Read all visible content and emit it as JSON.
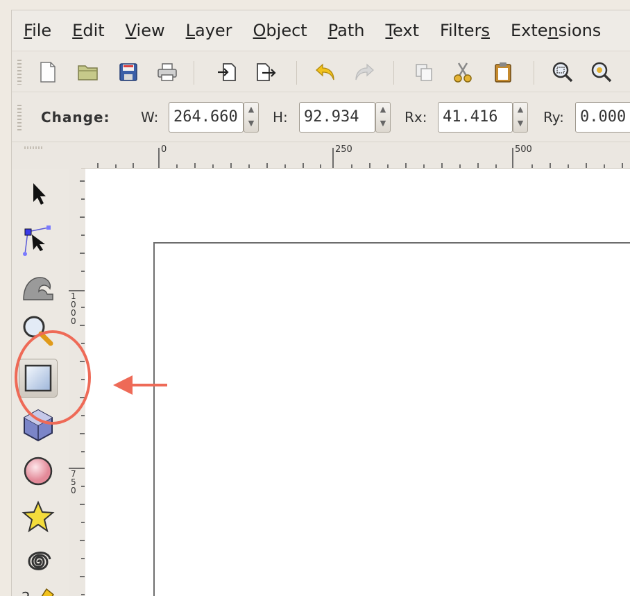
{
  "menubar": {
    "items": [
      {
        "mnemonic": "F",
        "rest": "ile"
      },
      {
        "mnemonic": "E",
        "rest": "dit"
      },
      {
        "mnemonic": "V",
        "rest": "iew"
      },
      {
        "mnemonic": "L",
        "rest": "ayer"
      },
      {
        "mnemonic": "O",
        "rest": "bject"
      },
      {
        "mnemonic": "P",
        "rest": "ath"
      },
      {
        "mnemonic": "T",
        "rest": "ext"
      },
      {
        "pre": "Filter",
        "mnemonic": "s",
        "rest": ""
      },
      {
        "pre": "Exte",
        "mnemonic": "n",
        "rest": "sions"
      }
    ]
  },
  "commands": {
    "icons": [
      "new-document-icon",
      "open-folder-icon",
      "save-icon",
      "print-icon",
      "import-icon",
      "export-icon",
      "undo-icon",
      "redo-icon",
      "duplicate-icon",
      "cut-icon",
      "paste-icon",
      "zoom-selection-icon",
      "zoom-drawing-icon"
    ]
  },
  "controls": {
    "change_label": "Change:",
    "w_label": "W:",
    "w_value": "264.660",
    "h_label": "H:",
    "h_value": "92.934",
    "rx_label": "Rx:",
    "rx_value": "41.416",
    "ry_label": "Ry:",
    "ry_value": "0.000"
  },
  "ruler": {
    "h_labels": [
      "0",
      "250",
      "500"
    ],
    "v_labels": [
      "1000",
      "750"
    ]
  },
  "toolbox": {
    "tools": [
      "selector-tool",
      "node-tool",
      "tweak-tool",
      "zoom-tool",
      "rectangle-tool",
      "3dbox-tool",
      "ellipse-tool",
      "star-tool",
      "spiral-tool",
      "pencil-tool"
    ],
    "active": "rectangle-tool",
    "partial_label": "2"
  },
  "colors": {
    "annotation": "#ee6a57",
    "page_border": "#6d6d6d"
  }
}
